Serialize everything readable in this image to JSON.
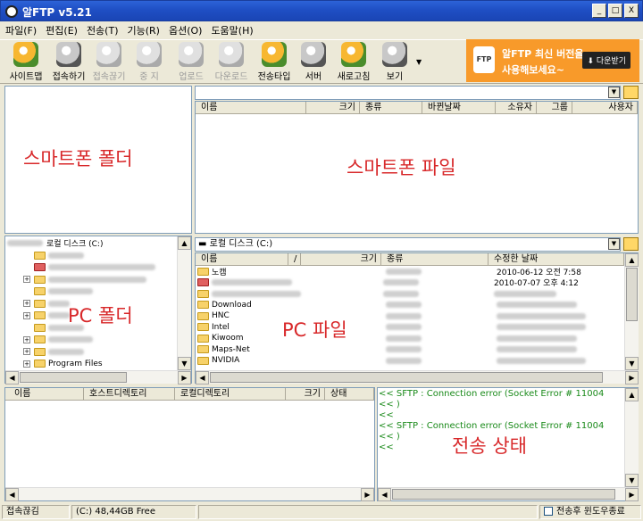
{
  "window": {
    "title": "알FTP v5.21",
    "buttons": [
      "_",
      "□",
      "X"
    ]
  },
  "menu": [
    "파일(F)",
    "편집(E)",
    "전송(T)",
    "기능(R)",
    "옵션(O)",
    "도움말(H)"
  ],
  "toolbar": [
    {
      "label": "사이트맵",
      "enabled": true,
      "icon": "sitemap-icon"
    },
    {
      "label": "접속하기",
      "enabled": true,
      "icon": "connect-icon"
    },
    {
      "label": "접속끊기",
      "enabled": false,
      "icon": "disconnect-icon"
    },
    {
      "label": "중  지",
      "enabled": false,
      "icon": "stop-icon"
    },
    {
      "label": "업로드",
      "enabled": false,
      "icon": "upload-icon"
    },
    {
      "label": "다운로드",
      "enabled": false,
      "icon": "download-icon"
    },
    {
      "label": "전송타입",
      "enabled": true,
      "icon": "transfer-type-icon"
    },
    {
      "label": "서버",
      "enabled": true,
      "icon": "server-icon"
    },
    {
      "label": "새로고침",
      "enabled": true,
      "icon": "refresh-icon"
    },
    {
      "label": "보기",
      "enabled": true,
      "icon": "view-icon"
    }
  ],
  "ad": {
    "logo": "FTP",
    "line1": "알FTP 최신 버전을",
    "line2": "사용해보세요~",
    "download": "다운받기"
  },
  "captions": {
    "phone_folder": "스마트폰 폴더",
    "phone_files": "스마트폰 파일",
    "pc_folder": "PC 폴더",
    "pc_files": "PC 파일",
    "transfer_status": "전송 상태"
  },
  "remote": {
    "columns": [
      "이름",
      "크기",
      "종류",
      "바뀐날짜",
      "소유자",
      "그룹",
      "사용자"
    ]
  },
  "local": {
    "path": "로컬 디스크 (C:)",
    "tree_root": "로컬 디스크 (C:)",
    "tree": [
      "노캠",
      "",
      "Documents and Settings",
      "Download",
      "HNC",
      "Intel",
      "Kiwoom",
      "Maps-Net",
      "NVIDIA",
      "Program Files"
    ],
    "columns": [
      "이름",
      "/",
      "크기",
      "종류",
      "수정한 날짜"
    ],
    "files": [
      {
        "name": "노캠",
        "date": "2010-06-12 오전 7:58"
      },
      {
        "name": "",
        "date": "2010-07-07 오후 4:12"
      },
      {
        "name": "Documents and...",
        "date": ""
      },
      {
        "name": "Download",
        "date": ""
      },
      {
        "name": "HNC",
        "date": ""
      },
      {
        "name": "Intel",
        "date": ""
      },
      {
        "name": "Kiwoom",
        "date": ""
      },
      {
        "name": "Maps-Net",
        "date": ""
      },
      {
        "name": "NVIDIA",
        "date": ""
      }
    ]
  },
  "queue": {
    "columns": [
      "이름",
      "호스트디렉토리",
      "로컬디렉토리",
      "크기",
      "상태"
    ]
  },
  "log": [
    "<< SFTP : Connection error (Socket Error # 11004",
    "<< )",
    "<<",
    "<< SFTP : Connection error (Socket Error # 11004",
    "<< )",
    "<<"
  ],
  "statusbar": {
    "connection": "접속끊김",
    "drive": "(C:)  48,44GB Free",
    "close_after": "전송후 윈도우종료"
  }
}
